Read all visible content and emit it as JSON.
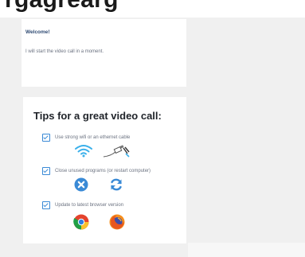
{
  "header": {
    "partial_heading": "rgagrearg"
  },
  "welcome": {
    "title": "Welcome!",
    "message": "I will start the video call in a moment."
  },
  "tips": {
    "title": "Tips for a great video call:",
    "items": [
      {
        "label": "Use strong wifi or an ethernet cable",
        "checked": true,
        "icons": [
          "wifi-icon",
          "ethernet-cable-icon"
        ]
      },
      {
        "label": "Close unused programs (or restart computer)",
        "checked": true,
        "icons": [
          "close-program-icon",
          "restart-icon"
        ]
      },
      {
        "label": "Update to latest browser version",
        "checked": true,
        "icons": [
          "chrome-icon",
          "firefox-icon"
        ]
      }
    ]
  },
  "colors": {
    "accent": "#3a8ad6",
    "background": "#f0f0f0",
    "card": "#ffffff",
    "title_text": "#2f4b73"
  }
}
